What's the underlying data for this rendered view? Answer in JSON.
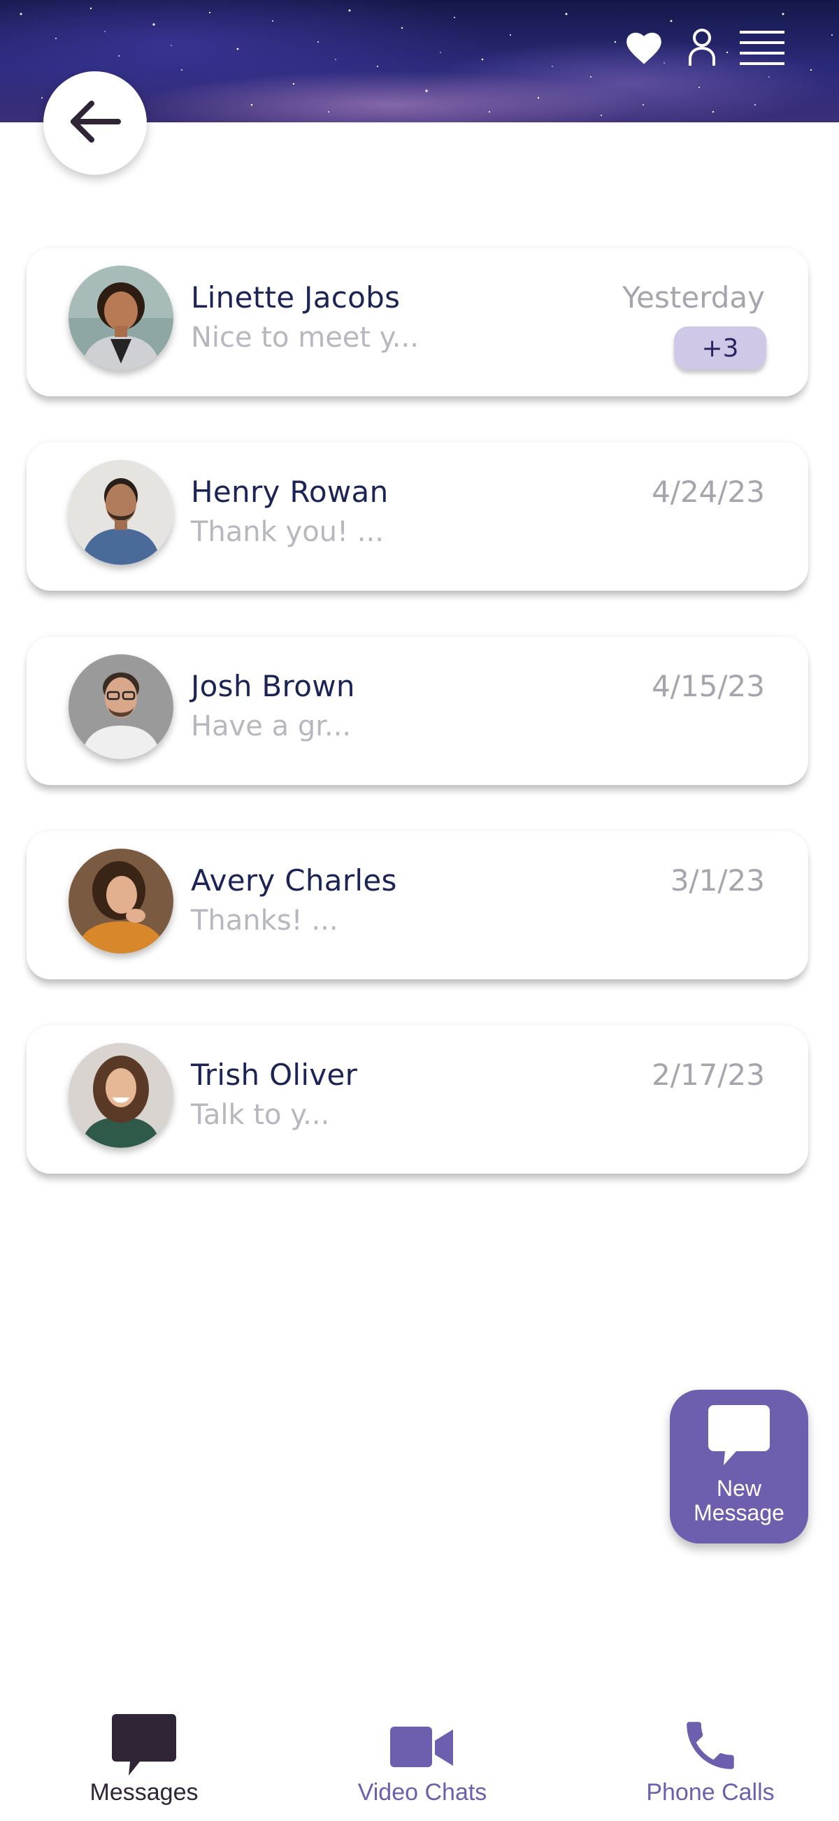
{
  "header": {
    "icons": [
      "heart-icon",
      "user-icon",
      "menu-icon"
    ]
  },
  "back_button": {
    "icon": "arrow-left-icon"
  },
  "conversations": [
    {
      "name": "Linette Jacobs",
      "preview": "Nice to meet y...",
      "date": "Yesterday",
      "badge": "+3"
    },
    {
      "name": "Henry Rowan",
      "preview": "Thank you! ...",
      "date": "4/24/23"
    },
    {
      "name": "Josh Brown",
      "preview": "Have a gr...",
      "date": "4/15/23"
    },
    {
      "name": "Avery Charles",
      "preview": "Thanks! ...",
      "date": "3/1/23"
    },
    {
      "name": "Trish Oliver",
      "preview": "Talk to y...",
      "date": "2/17/23"
    }
  ],
  "fab": {
    "line1": "New",
    "line2": "Message",
    "icon": "chat-bubble-icon"
  },
  "tabbar": {
    "tabs": [
      {
        "label": "Messages",
        "icon": "message-icon",
        "active": true
      },
      {
        "label": "Video Chats",
        "icon": "video-icon",
        "active": false
      },
      {
        "label": "Phone Calls",
        "icon": "phone-icon",
        "active": false
      }
    ]
  },
  "colors": {
    "name_text": "#1c2456",
    "preview_text": "#b7b7c0",
    "date_text": "#a5a5ae",
    "accent": "#6d5fad",
    "badge_bg": "#cfc8e6",
    "tab_active": "#2f2536",
    "tab_inactive": "#6d5fad"
  }
}
